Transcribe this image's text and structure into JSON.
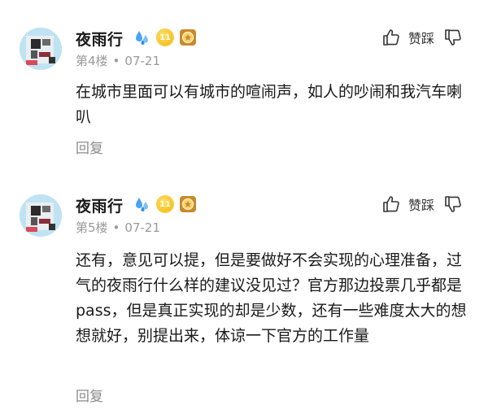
{
  "posts": [
    {
      "username": "夜雨行",
      "level": "11",
      "floor": "第4楼",
      "date": "07-21",
      "like_label": "赞踩",
      "content": "在城市里面可以有城市的喧闹声，如人的吵闹和我汽车喇叭",
      "reply_label": "回复"
    },
    {
      "username": "夜雨行",
      "level": "11",
      "floor": "第5楼",
      "date": "07-21",
      "like_label": "赞踩",
      "content": "还有，意见可以提，但是要做好不会实现的心理准备，过气的夜雨行什么样的建议没见过？官方那边投票几乎都是pass，但是真正实现的却是少数，还有一些难度太大的想想就好，别提出来，体谅一下官方的工作量",
      "reply_label": "回复"
    }
  ],
  "meta_separator": "•",
  "colors": {
    "text": "#1a1a1a",
    "muted": "#9a9a9a",
    "water_icon": "#4aa3f0",
    "level_badge": "#f4b400"
  }
}
